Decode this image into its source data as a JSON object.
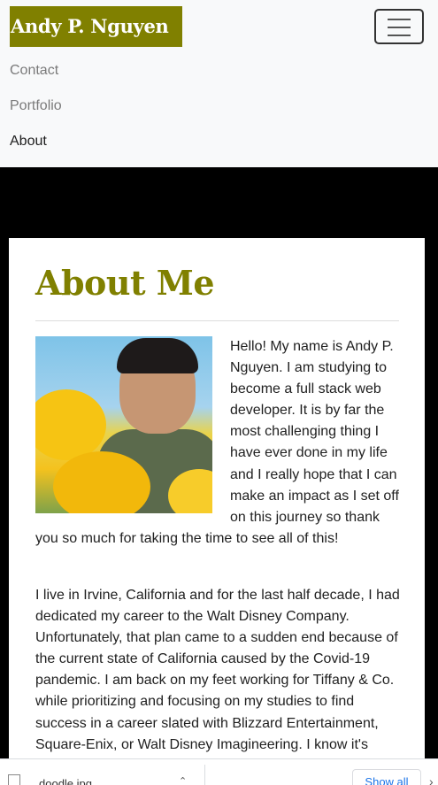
{
  "navbar": {
    "brand": "Andy P. Nguyen",
    "links": [
      {
        "label": "Contact",
        "active": false
      },
      {
        "label": "Portfolio",
        "active": false
      },
      {
        "label": "About",
        "active": true
      }
    ]
  },
  "about": {
    "title": "About Me",
    "paragraphs": [
      "Hello! My name is Andy P. Nguyen. I am studying to become a full stack web developer. It is by far the most challenging thing I have ever done in my life and I really hope that I can make an impact as I set off on this journey so thank you so much for taking the time to see all of this!",
      "I live in Irvine, California and for the last half decade, I had dedicated my career to the Walt Disney Company. Unfortunately, that plan came to a sudden end because of the current state of California caused by the Covid-19 pandemic. I am back on my feet working for Tiffany & Co. while prioritizing and focusing on my studies to find success in a career slated with Blizzard Entertainment, Square-Enix, or Walt Disney Imagineering. I know it's"
    ]
  },
  "download_bar": {
    "file_name": "doodle.jpg",
    "show_all": "Show all"
  },
  "colors": {
    "brand": "#808000",
    "navbar_bg": "#f8f9fa",
    "page_bg": "#000000"
  }
}
